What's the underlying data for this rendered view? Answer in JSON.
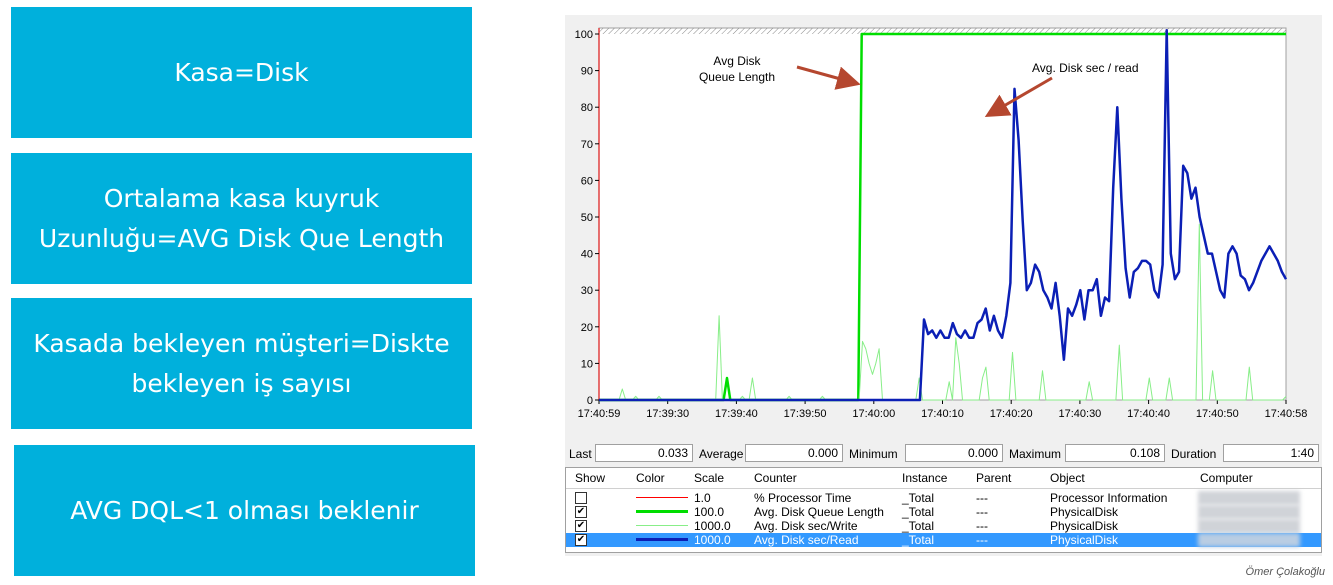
{
  "slides": {
    "box1": "Kasa=Disk",
    "box2_line1": "Ortalama kasa kuyruk",
    "box2_line2": "Uzunluğu=AVG Disk Que Length",
    "box3_line1": "Kasada bekleyen müşteri=Diskte",
    "box3_line2": "bekleyen iş sayısı",
    "box4": "AVG DQL<1 olması beklenir"
  },
  "annotations": {
    "queue_line1": "Avg Disk",
    "queue_line2": "Queue Length",
    "sec_read": "Avg. Disk sec / read"
  },
  "chart_data": {
    "type": "line",
    "y_ticks": [
      "0",
      "10",
      "20",
      "30",
      "40",
      "50",
      "60",
      "70",
      "80",
      "90",
      "100"
    ],
    "ylim": [
      0,
      100
    ],
    "x_ticks": [
      "17:40:59",
      "17:39:30",
      "17:39:40",
      "17:39:50",
      "17:40:00",
      "17:40:10",
      "17:40:20",
      "17:40:30",
      "17:40:40",
      "17:40:50",
      "17:40:58"
    ],
    "grid": false,
    "series": [
      {
        "name": "Avg. Disk Queue Length",
        "color": "#00dd00",
        "values": [
          0,
          0,
          0,
          0,
          0,
          0,
          0,
          0,
          0,
          0,
          0,
          0,
          0,
          0,
          0,
          0,
          0,
          0,
          0,
          0,
          0,
          0,
          0,
          0,
          0,
          0,
          0,
          0,
          0,
          0,
          0,
          0,
          0,
          0,
          0,
          0,
          0,
          0,
          6,
          0,
          0,
          0,
          0,
          0,
          0,
          0,
          0,
          0,
          0,
          0,
          0,
          0,
          0,
          0,
          0,
          0,
          0,
          0,
          0,
          0,
          0,
          0,
          0,
          0,
          0,
          0,
          0,
          0,
          0,
          0,
          0,
          0,
          0,
          0,
          0,
          0,
          0,
          0,
          100,
          100,
          100,
          100,
          100,
          100,
          100,
          100,
          100,
          100,
          100,
          100,
          100,
          100,
          100,
          100,
          100,
          100,
          100,
          100,
          100,
          100,
          100,
          100,
          100,
          100,
          100,
          100,
          100,
          100,
          100,
          100,
          100,
          100,
          100,
          100,
          100,
          100,
          100,
          100,
          100,
          100,
          100,
          100,
          100,
          100,
          100,
          100,
          100,
          100,
          100,
          100,
          100,
          100,
          100,
          100,
          100,
          100,
          100,
          100,
          100,
          100,
          100,
          100,
          100,
          100,
          100,
          100,
          100,
          100,
          100,
          100,
          100,
          100,
          100,
          100,
          100,
          100,
          100,
          100,
          100,
          100,
          100,
          100,
          100,
          100,
          100,
          100,
          100,
          100,
          100,
          100,
          100,
          100,
          100,
          100,
          100,
          100,
          100,
          100,
          100,
          100,
          100,
          100,
          100,
          100,
          100,
          100,
          100,
          100,
          100,
          100,
          100,
          100,
          100,
          100,
          100,
          100,
          100,
          100,
          100,
          100,
          100,
          100,
          100,
          100,
          100
        ]
      },
      {
        "name": "Avg. Disk sec/Write",
        "color": "#88ee88",
        "values": [
          0,
          0,
          0,
          0,
          0,
          0,
          0,
          3,
          0,
          0,
          0,
          1,
          0,
          0,
          0,
          0,
          0,
          0,
          1,
          0,
          0,
          0,
          0,
          0,
          0,
          0,
          0,
          0,
          0,
          0,
          0,
          0,
          0,
          0,
          0,
          0,
          23,
          0,
          0,
          0,
          0,
          0,
          0,
          1,
          0,
          0,
          6,
          0,
          0,
          0,
          0,
          0,
          0,
          0,
          0,
          0,
          0,
          1,
          0,
          0,
          0,
          0,
          0,
          0,
          0,
          0,
          0,
          1,
          0,
          0,
          0,
          0,
          0,
          0,
          0,
          0,
          0,
          0,
          0,
          16,
          14,
          10,
          7,
          10,
          14,
          0,
          0,
          0,
          0,
          0,
          0,
          0,
          0,
          0,
          0,
          0,
          6,
          0,
          0,
          0,
          0,
          0,
          0,
          0,
          0,
          5,
          0,
          17,
          10,
          0,
          0,
          0,
          0,
          0,
          0,
          6,
          9,
          0,
          0,
          0,
          0,
          0,
          0,
          0,
          13,
          0,
          0,
          0,
          0,
          0,
          0,
          0,
          0,
          8,
          0,
          0,
          0,
          0,
          0,
          0,
          0,
          0,
          0,
          0,
          0,
          0,
          0,
          5,
          0,
          0,
          0,
          0,
          0,
          0,
          0,
          0,
          15,
          0,
          0,
          0,
          0,
          0,
          0,
          0,
          0,
          6,
          0,
          0,
          0,
          0,
          0,
          6,
          0,
          0,
          0,
          0,
          0,
          0,
          0,
          0,
          48,
          0,
          0,
          0,
          8,
          0,
          0,
          0,
          0,
          0,
          0,
          0,
          0,
          0,
          0,
          9,
          0,
          0,
          0,
          0,
          0,
          0,
          0,
          0,
          0,
          0,
          1
        ]
      },
      {
        "name": "Avg. Disk sec/Read",
        "color": "#0b1fb5",
        "values": [
          0,
          0,
          0,
          0,
          0,
          0,
          0,
          0,
          0,
          0,
          0,
          0,
          0,
          0,
          0,
          0,
          0,
          0,
          0,
          0,
          0,
          0,
          0,
          0,
          0,
          0,
          0,
          0,
          0,
          0,
          0,
          0,
          0,
          0,
          0,
          0,
          0,
          0,
          0,
          0,
          0,
          0,
          0,
          0,
          0,
          0,
          0,
          0,
          0,
          0,
          0,
          0,
          0,
          0,
          0,
          0,
          0,
          0,
          0,
          0,
          0,
          0,
          0,
          0,
          0,
          0,
          0,
          0,
          0,
          0,
          0,
          0,
          0,
          0,
          0,
          0,
          0,
          0,
          0,
          22,
          18,
          19,
          17,
          19,
          17,
          17,
          21,
          18,
          17,
          19,
          17,
          17,
          21,
          22,
          25,
          19,
          23,
          19,
          17,
          23,
          32,
          85,
          71,
          49,
          30,
          32,
          37,
          35,
          30,
          28,
          25,
          32,
          23,
          11,
          25,
          23,
          26,
          30,
          22,
          30,
          30,
          33,
          23,
          28,
          27,
          58,
          80,
          55,
          36,
          28,
          35,
          36,
          38,
          38,
          37,
          30,
          28,
          37,
          101,
          40,
          33,
          35,
          64,
          62,
          55,
          58,
          50,
          45,
          40,
          40,
          35,
          30,
          28,
          40,
          42,
          40,
          34,
          33,
          30,
          32,
          35,
          38,
          40,
          42,
          40,
          38,
          35,
          33
        ]
      }
    ]
  },
  "stats": {
    "last_label": "Last",
    "last_value": "0.033",
    "average_label": "Average",
    "average_value": "0.000",
    "minimum_label": "Minimum",
    "minimum_value": "0.000",
    "maximum_label": "Maximum",
    "maximum_value": "0.108",
    "duration_label": "Duration",
    "duration_value": "1:40"
  },
  "table": {
    "headers": [
      "Show",
      "Color",
      "Scale",
      "Counter",
      "Instance",
      "Parent",
      "Object",
      "Computer"
    ],
    "rows": [
      {
        "checked": false,
        "color": "#ff0000",
        "scale": "1.0",
        "counter": "% Processor Time",
        "instance": "_Total",
        "parent": "---",
        "object": "Processor Information"
      },
      {
        "checked": true,
        "color": "#00dd00",
        "scale": "100.0",
        "counter": "Avg. Disk Queue Length",
        "instance": "_Total",
        "parent": "---",
        "object": "PhysicalDisk"
      },
      {
        "checked": true,
        "color": "#88ee88",
        "scale": "1000.0",
        "counter": "Avg. Disk sec/Write",
        "instance": "_Total",
        "parent": "---",
        "object": "PhysicalDisk"
      },
      {
        "checked": true,
        "color": "#0b1fb5",
        "scale": "1000.0",
        "counter": "Avg. Disk sec/Read",
        "instance": "_Total",
        "parent": "---",
        "object": "PhysicalDisk"
      }
    ]
  },
  "credit": "Ömer Çolakoğlu"
}
